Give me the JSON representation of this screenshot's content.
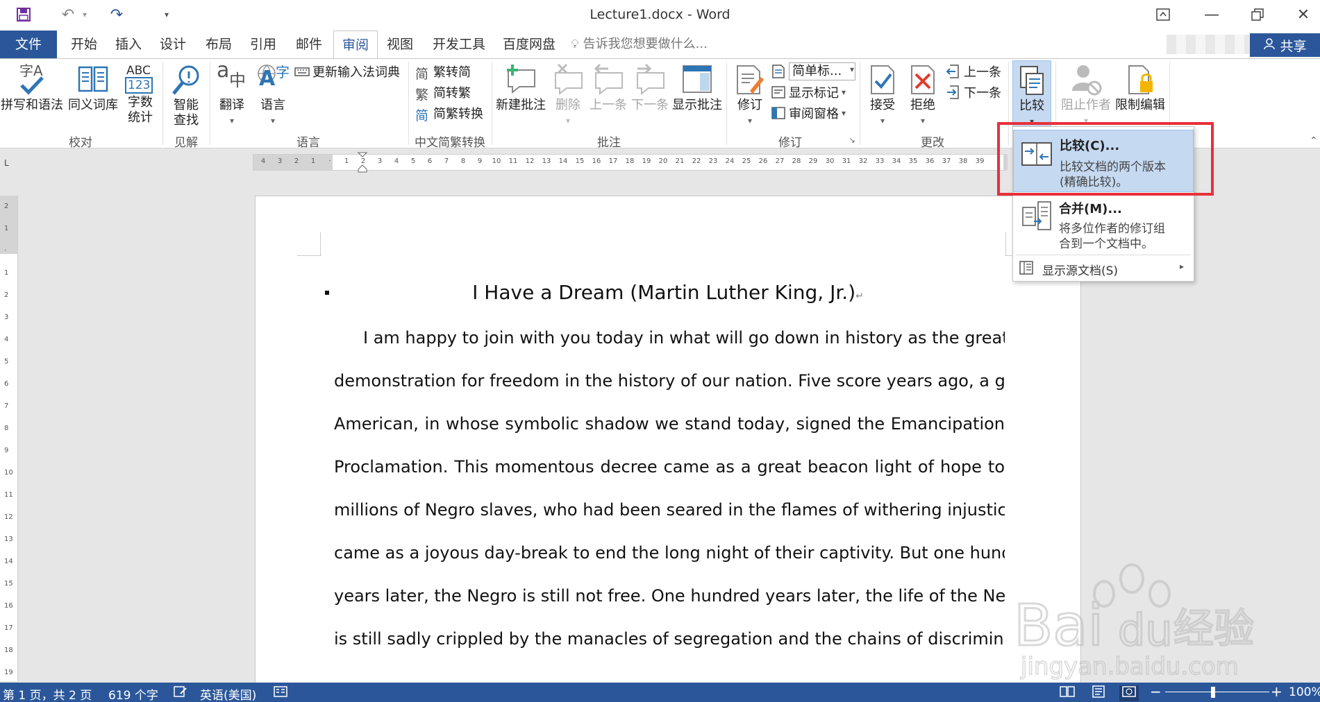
{
  "window": {
    "title": "Lecture1.docx - Word"
  },
  "tabs": [
    {
      "label": "文件"
    },
    {
      "label": "开始"
    },
    {
      "label": "插入"
    },
    {
      "label": "设计"
    },
    {
      "label": "布局"
    },
    {
      "label": "引用"
    },
    {
      "label": "邮件"
    },
    {
      "label": "审阅"
    },
    {
      "label": "视图"
    },
    {
      "label": "开发工具"
    },
    {
      "label": "百度网盘"
    }
  ],
  "tellme": {
    "placeholder": "告诉我您想要做什么..."
  },
  "share": {
    "label": "共享"
  },
  "ribbon": {
    "proofing": {
      "label": "校对",
      "spelling": "拼写和语法",
      "thesaurus": "同义词库",
      "wordcount_line1": "字数",
      "wordcount_line2": "统计",
      "abc": "ABC",
      "num": "123",
      "zi": "字A"
    },
    "insights": {
      "label": "见解",
      "smart_line1": "智能",
      "smart_line2": "查找"
    },
    "language": {
      "label": "语言",
      "translate": "翻译",
      "language": "语言",
      "update_ime": "更新输入法词典"
    },
    "chinese_conv": {
      "label": "中文简繁转换",
      "to_simplified": "繁转简",
      "to_traditional": "简转繁",
      "convert": "简繁转换",
      "ch_jian": "简",
      "ch_fan": "繁",
      "ch_jian2": "简"
    },
    "comments": {
      "label": "批注",
      "new": "新建批注",
      "delete": "删除",
      "prev": "上一条",
      "next": "下一条",
      "show": "显示批注"
    },
    "tracking": {
      "label": "修订",
      "track": "修订",
      "markup_select": "简单标...",
      "show_markup": "显示标记",
      "review_pane": "审阅窗格"
    },
    "changes": {
      "label": "更改",
      "accept": "接受",
      "reject": "拒绝",
      "prev": "上一条",
      "next": "下一条"
    },
    "compare": {
      "label": "比较"
    },
    "protect": {
      "block": "阻止作者",
      "restrict": "限制编辑"
    }
  },
  "compare_menu": {
    "compare": {
      "title": "比较(C)...",
      "desc1": "比较文档的两个版本",
      "desc2": "(精确比较)。"
    },
    "combine": {
      "title": "合并(M)...",
      "desc1": "将多位作者的修订组",
      "desc2": "合到一个文档中。"
    },
    "show_source": {
      "label": "显示源文档(S)"
    }
  },
  "ruler": {
    "corner": "L",
    "ticks": [
      "4",
      "3",
      "2",
      "1",
      "",
      "1",
      "2",
      "3",
      "4",
      "5",
      "6",
      "7",
      "8",
      "9",
      "10",
      "11",
      "12",
      "13",
      "14",
      "15",
      "16",
      "17",
      "18",
      "19",
      "20",
      "21",
      "22",
      "23",
      "24",
      "25",
      "26",
      "27",
      "28",
      "29",
      "30",
      "31",
      "32",
      "33",
      "34",
      "35",
      "36",
      "37",
      "38",
      "39"
    ],
    "vticks": [
      "2",
      "1",
      "",
      "1",
      "2",
      "3",
      "4",
      "5",
      "6",
      "7",
      "8",
      "9",
      "10",
      "11",
      "12",
      "13",
      "14",
      "15",
      "16",
      "17",
      "18",
      "19"
    ]
  },
  "document": {
    "heading": "I Have a Dream (Martin Luther King, Jr.)",
    "lines": [
      "I am happy to join with you today in what will go down in history as the greatest",
      "demonstration for freedom in the history of our nation.   Five score years ago, a great",
      "American, in whose symbolic shadow we stand today, signed the Emancipation",
      "Proclamation. This momentous decree came as a great beacon light of hope to",
      "millions of Negro slaves, who had been seared in the flames of withering injustice. It",
      "came as a joyous day-break to end the long night of their captivity.   But one hundred",
      "years later, the Negro is still not free. One hundred years later, the life of the Negro",
      "is still sadly crippled by the manacles of segregation and the chains of discrimination."
    ]
  },
  "status": {
    "page": "第 1 页，共 2 页",
    "words": "619 个字",
    "lang": "英语(美国)",
    "zoom": "100%"
  },
  "watermark": {
    "brand": "Bai",
    "brand2": "du",
    "jingyan": "经验",
    "url": "jingyan.baidu.com"
  },
  "colors": {
    "accent": "#2b579a",
    "highlight": "#e8303a",
    "menu_hover": "#c5d9f1"
  }
}
